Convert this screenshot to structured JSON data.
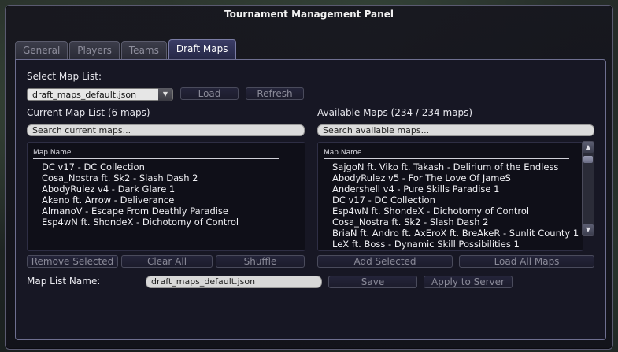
{
  "window": {
    "title": "Tournament Management Panel"
  },
  "tabs": [
    {
      "label": "General"
    },
    {
      "label": "Players"
    },
    {
      "label": "Teams"
    },
    {
      "label": "Draft Maps",
      "active": true
    }
  ],
  "select_map_list": {
    "label": "Select Map List:",
    "selected": "draft_maps_default.json",
    "load_label": "Load",
    "refresh_label": "Refresh"
  },
  "current": {
    "header": "Current Map List (6 maps)",
    "search_placeholder": "Search current maps...",
    "column": "Map Name",
    "rows": [
      "DC v17 - DC Collection",
      "Cosa_Nostra ft. Sk2 - Slash Dash 2",
      "AbodyRulez v4 - Dark Glare 1",
      "Akeno ft. Arrow - Deliverance",
      "AlmanoV - Escape From Deathly Paradise",
      "Esp4wN ft. ShondeX - Dichotomy of Control"
    ],
    "remove_label": "Remove Selected",
    "clear_label": "Clear All",
    "shuffle_label": "Shuffle"
  },
  "available": {
    "header": "Available Maps (234 / 234 maps)",
    "search_placeholder": "Search available maps...",
    "column": "Map Name",
    "rows": [
      "SajgoN ft. Viko ft. Takash - Delirium of the Endless",
      "AbodyRulez v5 - For The Love Of JameS",
      "Andershell v4 - Pure Skills Paradise 1",
      "DC v17 - DC Collection",
      "Esp4wN ft. ShondeX - Dichotomy of Control",
      "Cosa_Nostra ft. Sk2 - Slash Dash 2",
      "BriaN ft. Andro ft. AxEroX ft. BreAkeR - Sunlit County 1",
      "LeX ft. Boss - Dynamic Skill Possibilities 1"
    ],
    "scroll_up_icon": "chevron-up-icon",
    "scroll_down_icon": "chevron-down-icon",
    "add_label": "Add Selected",
    "load_all_label": "Load All Maps"
  },
  "footer": {
    "name_label": "Map List Name:",
    "name_value": "draft_maps_default.json",
    "save_label": "Save",
    "apply_label": "Apply to Server"
  }
}
